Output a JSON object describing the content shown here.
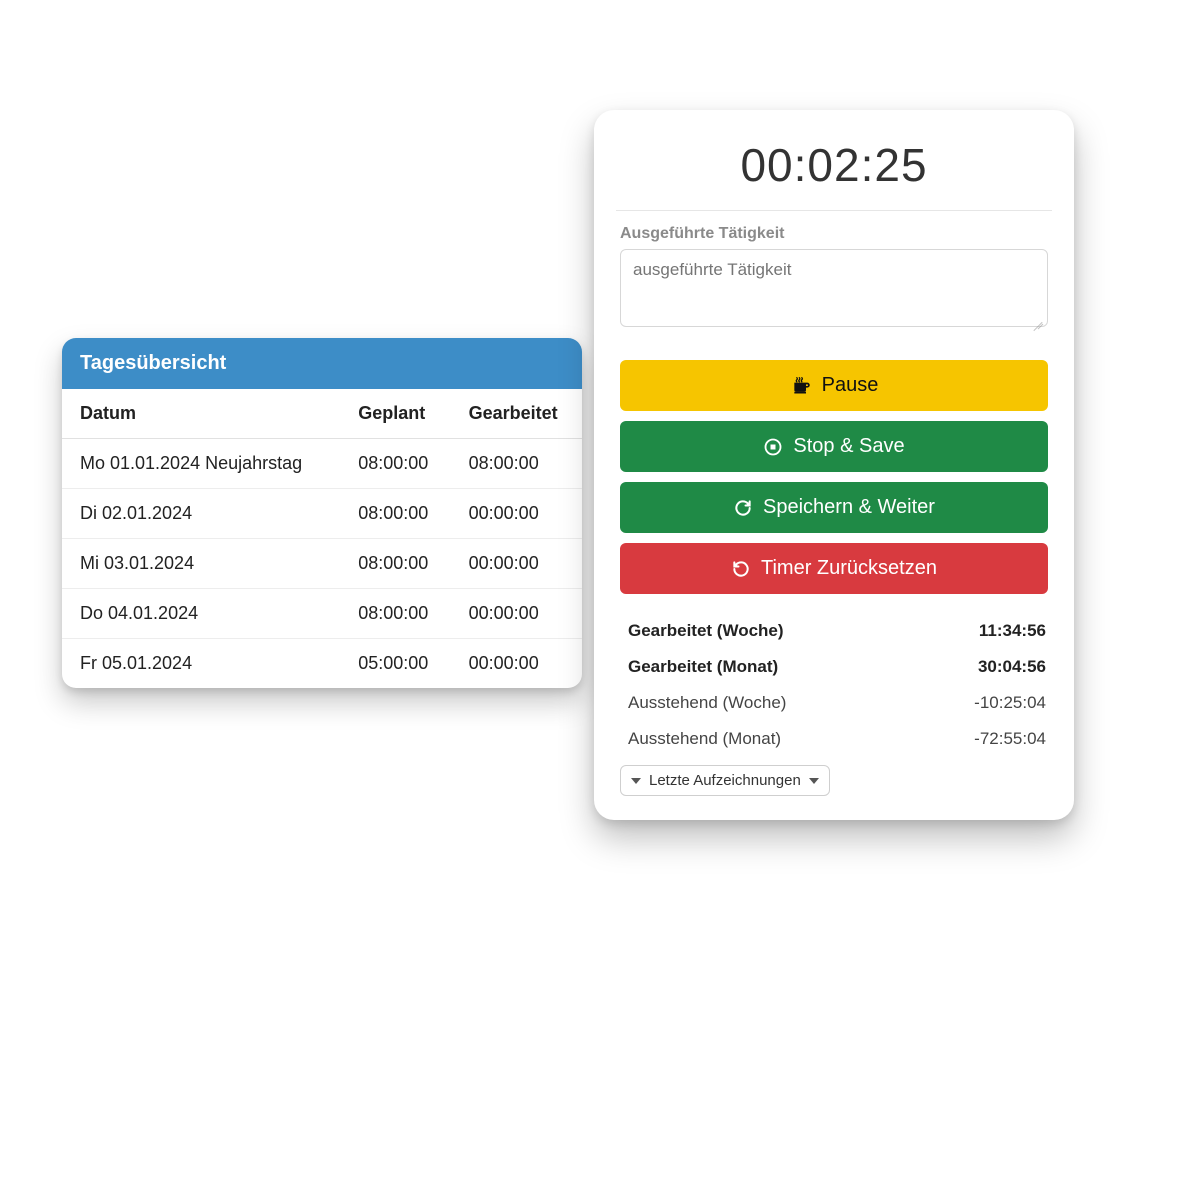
{
  "overview": {
    "title": "Tagesübersicht",
    "columns": {
      "date": "Datum",
      "planned": "Geplant",
      "worked": "Gearbeitet"
    },
    "rows": [
      {
        "date": "Mo 01.01.2024 Neujahrstag",
        "planned": "08:00:00",
        "worked": "08:00:00",
        "link": true
      },
      {
        "date": "Di 02.01.2024",
        "planned": "08:00:00",
        "worked": "00:00:00",
        "link": false
      },
      {
        "date": "Mi 03.01.2024",
        "planned": "08:00:00",
        "worked": "00:00:00",
        "link": false
      },
      {
        "date": "Do 04.01.2024",
        "planned": "08:00:00",
        "worked": "00:00:00",
        "link": false
      },
      {
        "date": "Fr 05.01.2024",
        "planned": "05:00:00",
        "worked": "00:00:00",
        "link": false
      }
    ]
  },
  "timer": {
    "display": "00:02:25",
    "activity_label": "Ausgeführte Tätigkeit",
    "activity_placeholder": "ausgeführte Tätigkeit",
    "buttons": {
      "pause": "Pause",
      "stop_save": "Stop & Save",
      "save_continue": "Speichern & Weiter",
      "reset": "Timer Zurücksetzen"
    },
    "summary": {
      "worked_week_label": "Gearbeitet (Woche)",
      "worked_week_value": "11:34:56",
      "worked_month_label": "Gearbeitet (Monat)",
      "worked_month_value": "30:04:56",
      "pending_week_label": "Ausstehend (Woche)",
      "pending_week_value": "-10:25:04",
      "pending_month_label": "Ausstehend (Monat)",
      "pending_month_value": "-72:55:04"
    },
    "recent_label": "Letzte Aufzeichnungen"
  }
}
